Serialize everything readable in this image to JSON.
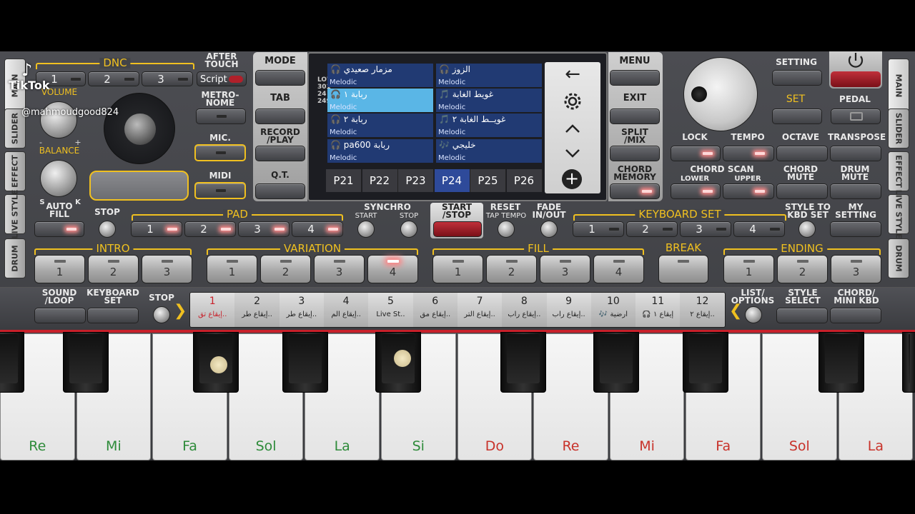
{
  "overlay": {
    "logo": "TikTok",
    "handle": "@mahmoudgood824"
  },
  "left_tabs": [
    "MAIN",
    "SLIDER",
    "EFFECT",
    "LIVE STYLE",
    "DRUM"
  ],
  "right_tabs": [
    "MAIN",
    "SLIDER",
    "EFFECT",
    "LIVE STYLE",
    "DRUM"
  ],
  "dnc": {
    "label": "DNC",
    "buttons": [
      "1",
      "2",
      "3"
    ],
    "after_touch": "AFTER TOUCH",
    "script": "Script"
  },
  "knobs": {
    "volume": "VOLUME",
    "balance": "BALANCE",
    "bal_s": "S",
    "bal_k": "K",
    "minus": "-",
    "plus": "+"
  },
  "mid_left": {
    "metronome": "METRO-\nNOME",
    "mic": "MIC.",
    "midi": "MIDI"
  },
  "center_left": {
    "mode": "MODE",
    "tab": "TAB",
    "record": "RECORD\n/PLAY",
    "qt": "Q.T."
  },
  "screen": {
    "side_letters": "LOW\n301\n24\n249",
    "cells": [
      {
        "title": "🎧 مزمار صعيدي",
        "sub": "Melodic"
      },
      {
        "title": "🎧 الزوز",
        "sub": "Melodic"
      },
      {
        "title": "🎧 ربابة ١",
        "sub": "Melodic"
      },
      {
        "title": "🎵 غويط الغابة",
        "sub": "Melodic"
      },
      {
        "title": "🎧 ربابة ٢",
        "sub": "Melodic"
      },
      {
        "title": "🎵 غويــط الغابة ٢",
        "sub": "Melodic"
      },
      {
        "title": "🎧 pa600 ربابة",
        "sub": "Melodic"
      },
      {
        "title": "🎶 خليجي",
        "sub": "Melodic"
      }
    ],
    "pages": [
      "P21",
      "P22",
      "P23",
      "P24",
      "P25",
      "P26"
    ],
    "selected_page": "P24",
    "icons": [
      "back-arrow-icon",
      "gear-icon",
      "chevron-up-icon",
      "chevron-down-icon",
      "add-icon"
    ],
    "glyphs": {
      "back": "←",
      "up": "⌃",
      "down": "⌄",
      "add": "+"
    }
  },
  "center_right": {
    "menu": "MENU",
    "exit": "EXIT",
    "split": "SPLIT\n/MIX",
    "chord_memory": "CHORD\nMEMORY"
  },
  "top_right": {
    "setting": "SETTING",
    "set": "SET",
    "pedal": "PEDAL",
    "lock": "LOCK",
    "tempo": "TEMPO",
    "octave": "OCTAVE",
    "transpose": "TRANSPOSE",
    "chord_scan": "CHORD SCAN",
    "lower": "LOWER",
    "upper": "UPPER",
    "chord_mute": "CHORD\nMUTE",
    "drum_mute": "DRUM\nMUTE"
  },
  "row3": {
    "auto_fill": "AUTO\nFILL",
    "stop": "STOP",
    "pad": "PAD",
    "pad_buttons": [
      "1",
      "2",
      "3",
      "4"
    ],
    "synchro": "SYNCHRO",
    "synchro_start": "START",
    "synchro_stop": "STOP",
    "start_stop": "START\n/STOP",
    "reset": "RESET",
    "tap_tempo": "TAP TEMPO",
    "fade": "FADE\nIN/OUT",
    "keyboard_set": "KEYBOARD SET",
    "kbd_buttons": [
      "1",
      "2",
      "3",
      "4"
    ],
    "style_to_kbd": "STYLE TO\nKBD SET",
    "my_setting": "MY\nSETTING"
  },
  "row4": {
    "intro": "INTRO",
    "intro_buttons": [
      "1",
      "2",
      "3"
    ],
    "variation": "VARIATION",
    "variation_buttons": [
      "1",
      "2",
      "3",
      "4"
    ],
    "fill": "FILL",
    "fill_buttons": [
      "1",
      "2",
      "3",
      "4"
    ],
    "break": "BREAK",
    "ending": "ENDING",
    "ending_buttons": [
      "1",
      "2",
      "3"
    ]
  },
  "row5": {
    "sound_loop": "SOUND\n/LOOP",
    "keyboard_set": "KEYBOARD\nSET",
    "stop": "STOP",
    "list_options": "LIST/\nOPTIONS",
    "style_select": "STYLE\nSELECT",
    "chord_mini": "CHORD/\nMINI KBD"
  },
  "style_strip": [
    {
      "n": "1",
      "t": "إيقاع تق.."
    },
    {
      "n": "2",
      "t": "إيقاع طر.."
    },
    {
      "n": "3",
      "t": "إيقاع طر.."
    },
    {
      "n": "4",
      "t": "إيقاع الم.."
    },
    {
      "n": "5",
      "t": "Live St.."
    },
    {
      "n": "6",
      "t": "إيقاع مق.."
    },
    {
      "n": "7",
      "t": "إيقاع التر.."
    },
    {
      "n": "8",
      "t": "إيقاع راب.."
    },
    {
      "n": "9",
      "t": "إيقاع راب.."
    },
    {
      "n": "10",
      "t": "🎶 أرضية"
    },
    {
      "n": "11",
      "t": "🎧 إيقاع ١"
    },
    {
      "n": "12",
      "t": "إيقاع ٢.."
    }
  ],
  "keys": {
    "white": [
      "Re",
      "Mi",
      "Fa",
      "Sol",
      "La",
      "Si",
      "Do",
      "Re",
      "Mi",
      "Fa",
      "Sol",
      "La"
    ],
    "colors": {
      "green": "#2e8b3a",
      "red": "#c8322a",
      "accent": "#f0c020",
      "screen_cell": "#213a73",
      "screen_sel": "#5ab6e6"
    }
  }
}
